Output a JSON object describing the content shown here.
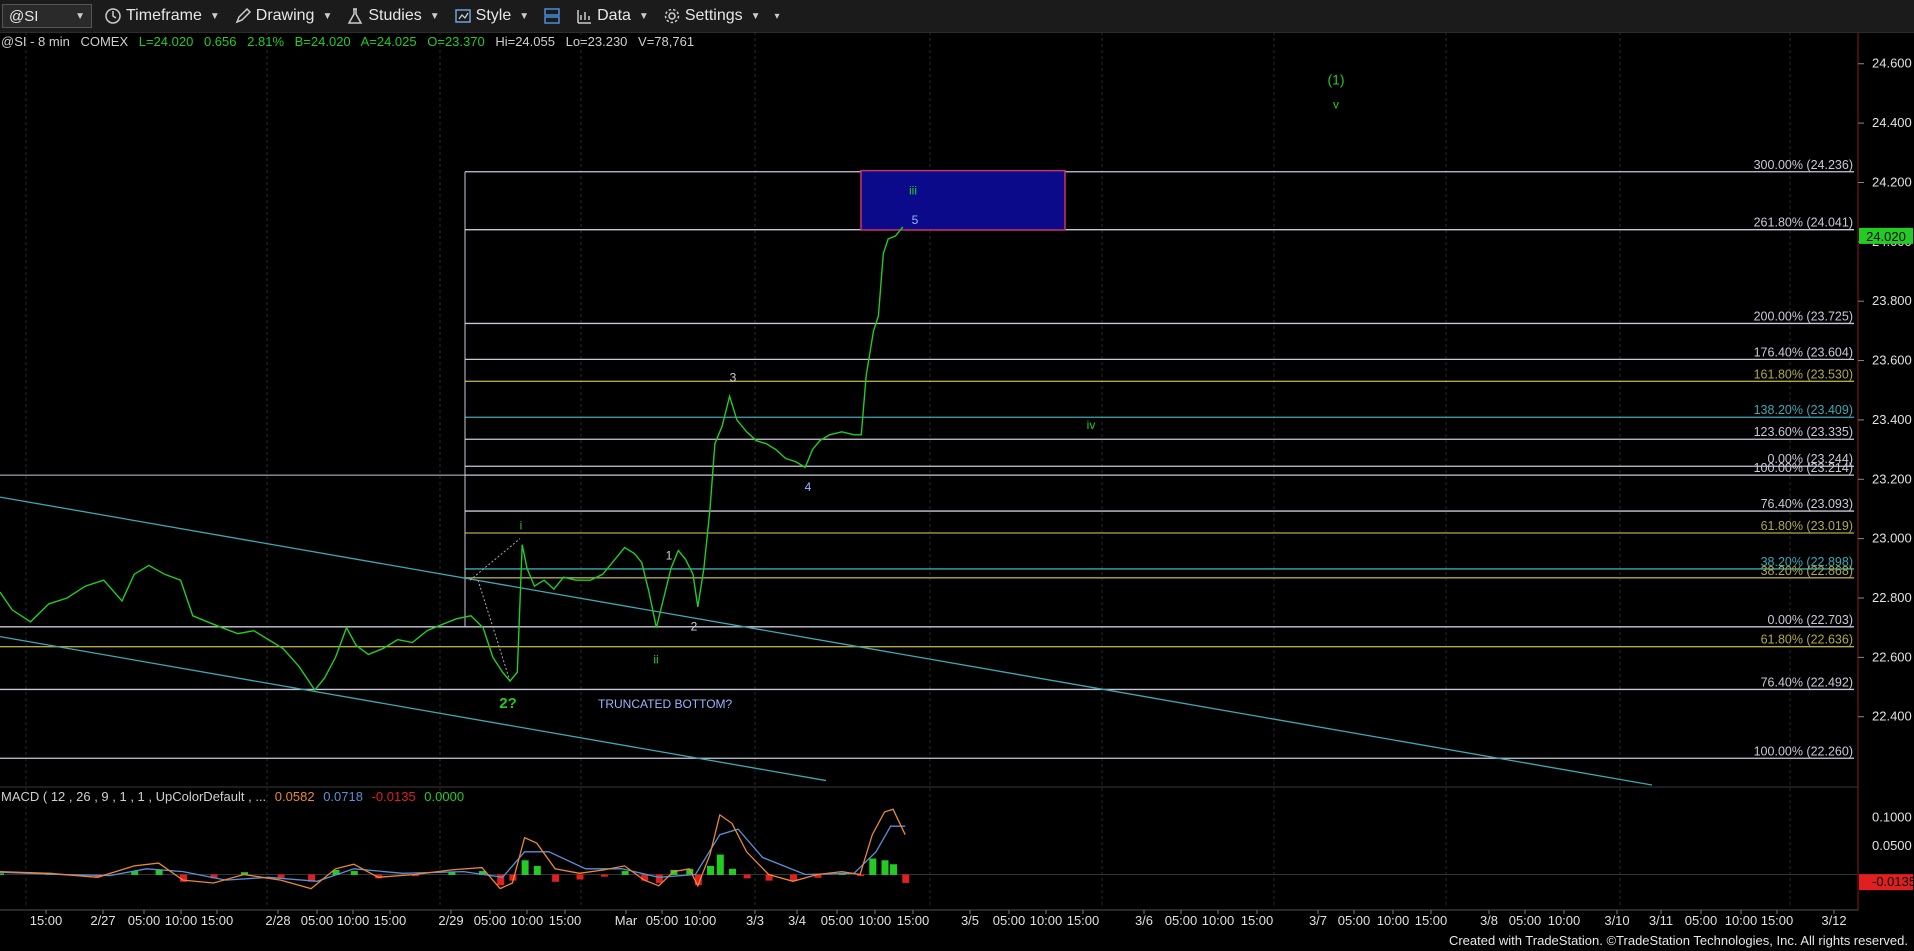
{
  "toolbar": {
    "symbol": "@SI",
    "timeframe_label": "Timeframe",
    "drawing_label": "Drawing",
    "studies_label": "Studies",
    "style_label": "Style",
    "data_label": "Data",
    "settings_label": "Settings"
  },
  "quote": {
    "symbol_desc": "@SI - 8 min",
    "exchange": "COMEX",
    "last": "L=24.020",
    "change": "0.656",
    "pct": "2.81%",
    "bid": "B=24.020",
    "ask": "A=24.025",
    "open": "O=23.370",
    "high": "Hi=24.055",
    "low": "Lo=23.230",
    "volume": "V=78,761"
  },
  "macd_label": {
    "name": "MACD ( 12 , 26 , 9 , 1 , 1 , UpColorDefault , ...",
    "v1": "0.0582",
    "v2": "0.0718",
    "v3": "-0.0135",
    "v4": "0.0000"
  },
  "footer": "Created with TradeStation. ©TradeStation Technologies, Inc. All rights reserved.",
  "colors": {
    "price": "#22cc22",
    "fib_line": "#c8c8d8",
    "trend_channel": "#3fa7b5",
    "target_box": "#0a0a8a",
    "box_border": "#cc3366",
    "macd_line": "#e8883a",
    "signal_line": "#5b8fd6",
    "hist_up": "#22cc22",
    "hist_down": "#e02020"
  },
  "chart_data": {
    "type": "line",
    "symbol": "@SI",
    "interval": "8 min",
    "y_ticks": [
      "24.600",
      "24.400",
      "24.200",
      "24.000",
      "23.800",
      "23.600",
      "23.400",
      "23.200",
      "23.000",
      "22.800",
      "22.600",
      "22.400"
    ],
    "ylim": [
      22.17,
      24.68
    ],
    "last_price_label": "24.020",
    "x_ticks": [
      "15:00",
      "2/27",
      "05:00",
      "10:00",
      "15:00",
      "2/28",
      "05:00",
      "10:00",
      "15:00",
      "2/29",
      "05:00",
      "10:00",
      "15:00",
      "Mar",
      "05:00",
      "10:00",
      "3/3",
      "3/4",
      "05:00",
      "10:00",
      "15:00",
      "3/5",
      "05:00",
      "10:00",
      "15:00",
      "3/6",
      "05:00",
      "10:00",
      "15:00",
      "3/7",
      "05:00",
      "10:00",
      "15:00",
      "3/8",
      "05:00",
      "10:00",
      "3/10",
      "3/11",
      "05:00",
      "10:00",
      "15:00",
      "3/12"
    ],
    "price_series": {
      "name": "@SI",
      "points": [
        [
          0,
          22.82
        ],
        [
          10,
          22.76
        ],
        [
          25,
          22.72
        ],
        [
          40,
          22.78
        ],
        [
          55,
          22.8
        ],
        [
          70,
          22.84
        ],
        [
          85,
          22.86
        ],
        [
          100,
          22.79
        ],
        [
          110,
          22.88
        ],
        [
          122,
          22.91
        ],
        [
          135,
          22.88
        ],
        [
          148,
          22.86
        ],
        [
          158,
          22.74
        ],
        [
          170,
          22.72
        ],
        [
          182,
          22.7
        ],
        [
          195,
          22.68
        ],
        [
          208,
          22.69
        ],
        [
          220,
          22.66
        ],
        [
          232,
          22.63
        ],
        [
          245,
          22.57
        ],
        [
          258,
          22.49
        ],
        [
          266,
          22.53
        ],
        [
          275,
          22.6
        ],
        [
          284,
          22.7
        ],
        [
          292,
          22.64
        ],
        [
          302,
          22.61
        ],
        [
          314,
          22.63
        ],
        [
          326,
          22.66
        ],
        [
          338,
          22.65
        ],
        [
          350,
          22.69
        ],
        [
          362,
          22.71
        ],
        [
          374,
          22.73
        ],
        [
          386,
          22.74
        ],
        [
          396,
          22.7
        ],
        [
          404,
          22.6
        ],
        [
          412,
          22.55
        ],
        [
          418,
          22.52
        ],
        [
          424,
          22.55
        ],
        [
          428,
          22.98
        ],
        [
          432,
          22.9
        ],
        [
          438,
          22.84
        ],
        [
          446,
          22.86
        ],
        [
          454,
          22.83
        ],
        [
          462,
          22.87
        ],
        [
          472,
          22.86
        ],
        [
          484,
          22.86
        ],
        [
          494,
          22.88
        ],
        [
          504,
          22.93
        ],
        [
          512,
          22.97
        ],
        [
          520,
          22.95
        ],
        [
          526,
          22.92
        ],
        [
          532,
          22.82
        ],
        [
          538,
          22.7
        ],
        [
          544,
          22.8
        ],
        [
          550,
          22.9
        ],
        [
          556,
          22.96
        ],
        [
          562,
          22.93
        ],
        [
          568,
          22.88
        ],
        [
          572,
          22.77
        ],
        [
          577,
          22.9
        ],
        [
          582,
          23.1
        ],
        [
          586,
          23.32
        ],
        [
          592,
          23.38
        ],
        [
          598,
          23.48
        ],
        [
          604,
          23.4
        ],
        [
          612,
          23.36
        ],
        [
          620,
          23.33
        ],
        [
          628,
          23.32
        ],
        [
          636,
          23.3
        ],
        [
          644,
          23.27
        ],
        [
          652,
          23.26
        ],
        [
          660,
          23.24
        ],
        [
          666,
          23.3
        ],
        [
          672,
          23.33
        ],
        [
          680,
          23.35
        ],
        [
          690,
          23.36
        ],
        [
          700,
          23.35
        ],
        [
          706,
          23.35
        ],
        [
          710,
          23.55
        ],
        [
          716,
          23.7
        ],
        [
          720,
          23.75
        ],
        [
          724,
          23.96
        ],
        [
          728,
          24.01
        ],
        [
          734,
          24.02
        ],
        [
          740,
          24.05
        ]
      ]
    },
    "fib_levels": [
      {
        "label": "300.00% (24.236)",
        "price": 24.236,
        "color": "#c8c8d8"
      },
      {
        "label": "261.80% (24.041)",
        "price": 24.041,
        "color": "#c8c8d8"
      },
      {
        "label": "200.00% (23.725)",
        "price": 23.725,
        "color": "#c8c8d8"
      },
      {
        "label": "176.40% (23.604)",
        "price": 23.604,
        "color": "#c8c8d8"
      },
      {
        "label": "161.80% (23.530)",
        "price": 23.53,
        "color": "#b0a84a"
      },
      {
        "label": "138.20% (23.409)",
        "price": 23.409,
        "color": "#3fa7b5"
      },
      {
        "label": "123.60% (23.335)",
        "price": 23.335,
        "color": "#c8c8d8"
      },
      {
        "label": "0.00% (23.244)",
        "price": 23.244,
        "color": "#c8c8d8"
      },
      {
        "label": "100.00% (23.214)",
        "price": 23.214,
        "color": "#c8c8d8"
      },
      {
        "label": "76.40% (23.093)",
        "price": 23.093,
        "color": "#c8c8d8"
      },
      {
        "label": "61.80% (23.019)",
        "price": 23.019,
        "color": "#b0a84a"
      },
      {
        "label": "38.20% (22.898)",
        "price": 22.898,
        "color": "#3fa7b5"
      },
      {
        "label": "38.20% (22.868)",
        "price": 22.868,
        "color": "#b0a84a"
      },
      {
        "label": "0.00% (22.703)",
        "price": 22.703,
        "color": "#c8c8d8"
      },
      {
        "label": "61.80% (22.636)",
        "price": 22.636,
        "color": "#b0a84a"
      },
      {
        "label": "76.40% (22.492)",
        "price": 22.492,
        "color": "#c8c8d8"
      },
      {
        "label": "100.00% (22.260)",
        "price": 22.26,
        "color": "#c8c8d8"
      }
    ],
    "wave_labels": [
      {
        "text": "(1)",
        "color": "#22cc22"
      },
      {
        "text": "v",
        "color": "#22cc22"
      },
      {
        "text": "iii",
        "color": "#22cc22"
      },
      {
        "text": "5",
        "color": "#9ab4ff"
      },
      {
        "text": "3",
        "color": "#d0d0d0"
      },
      {
        "text": "iv",
        "color": "#22cc22"
      },
      {
        "text": "4",
        "color": "#9ab4ff"
      },
      {
        "text": "i",
        "color": "#22cc22"
      },
      {
        "text": "1",
        "color": "#d0d0d0"
      },
      {
        "text": "2",
        "color": "#d0d0d0"
      },
      {
        "text": "ii",
        "color": "#22cc22"
      },
      {
        "text": "2?",
        "color": "#22cc22"
      },
      {
        "text": "TRUNCATED BOTTOM?",
        "color": "#9ab4ff"
      }
    ],
    "macd": {
      "y_ticks": [
        "0.1000",
        "0.0500",
        "-0.0135"
      ],
      "ylim": [
        -0.045,
        0.14
      ],
      "macd": [
        [
          0,
          0.005
        ],
        [
          40,
          0.002
        ],
        [
          80,
          -0.005
        ],
        [
          110,
          0.015
        ],
        [
          130,
          0.02
        ],
        [
          150,
          -0.01
        ],
        [
          175,
          -0.015
        ],
        [
          200,
          0.0
        ],
        [
          230,
          -0.01
        ],
        [
          255,
          -0.025
        ],
        [
          275,
          0.01
        ],
        [
          290,
          0.018
        ],
        [
          310,
          -0.005
        ],
        [
          340,
          0.0
        ],
        [
          370,
          0.008
        ],
        [
          395,
          0.012
        ],
        [
          410,
          -0.025
        ],
        [
          420,
          -0.015
        ],
        [
          430,
          0.065
        ],
        [
          440,
          0.055
        ],
        [
          455,
          0.01
        ],
        [
          475,
          0.002
        ],
        [
          495,
          0.008
        ],
        [
          512,
          0.015
        ],
        [
          528,
          -0.01
        ],
        [
          540,
          -0.02
        ],
        [
          552,
          0.005
        ],
        [
          565,
          0.01
        ],
        [
          572,
          -0.02
        ],
        [
          582,
          0.035
        ],
        [
          590,
          0.105
        ],
        [
          600,
          0.09
        ],
        [
          612,
          0.04
        ],
        [
          630,
          0.0
        ],
        [
          650,
          -0.012
        ],
        [
          670,
          0.0
        ],
        [
          690,
          0.005
        ],
        [
          705,
          0.0
        ],
        [
          715,
          0.07
        ],
        [
          725,
          0.11
        ],
        [
          732,
          0.115
        ],
        [
          742,
          0.07
        ]
      ],
      "signal": [
        [
          0,
          0.004
        ],
        [
          50,
          0.0
        ],
        [
          90,
          -0.002
        ],
        [
          120,
          0.01
        ],
        [
          150,
          0.005
        ],
        [
          185,
          -0.01
        ],
        [
          220,
          -0.005
        ],
        [
          260,
          -0.012
        ],
        [
          290,
          0.01
        ],
        [
          330,
          0.002
        ],
        [
          380,
          0.005
        ],
        [
          412,
          -0.005
        ],
        [
          430,
          0.04
        ],
        [
          450,
          0.04
        ],
        [
          480,
          0.01
        ],
        [
          510,
          0.01
        ],
        [
          540,
          -0.005
        ],
        [
          570,
          0.0
        ],
        [
          590,
          0.07
        ],
        [
          605,
          0.08
        ],
        [
          625,
          0.03
        ],
        [
          660,
          0.0
        ],
        [
          700,
          0.002
        ],
        [
          718,
          0.04
        ],
        [
          730,
          0.085
        ],
        [
          742,
          0.085
        ]
      ],
      "hist": [
        [
          0,
          0.002
        ],
        [
          40,
          0.003
        ],
        [
          80,
          -0.004
        ],
        [
          110,
          0.006
        ],
        [
          130,
          0.008
        ],
        [
          150,
          -0.012
        ],
        [
          175,
          -0.006
        ],
        [
          200,
          0.004
        ],
        [
          230,
          -0.005
        ],
        [
          255,
          -0.012
        ],
        [
          275,
          0.008
        ],
        [
          290,
          0.006
        ],
        [
          310,
          -0.006
        ],
        [
          340,
          -0.002
        ],
        [
          370,
          0.004
        ],
        [
          395,
          0.006
        ],
        [
          410,
          -0.018
        ],
        [
          420,
          -0.01
        ],
        [
          430,
          0.025
        ],
        [
          440,
          0.015
        ],
        [
          455,
          -0.012
        ],
        [
          475,
          -0.008
        ],
        [
          495,
          -0.003
        ],
        [
          512,
          0.006
        ],
        [
          528,
          -0.01
        ],
        [
          540,
          -0.014
        ],
        [
          552,
          0.008
        ],
        [
          565,
          0.01
        ],
        [
          572,
          -0.018
        ],
        [
          582,
          0.015
        ],
        [
          590,
          0.035
        ],
        [
          600,
          0.01
        ],
        [
          612,
          -0.006
        ],
        [
          630,
          -0.01
        ],
        [
          650,
          -0.01
        ],
        [
          670,
          -0.005
        ],
        [
          690,
          0.003
        ],
        [
          705,
          -0.002
        ],
        [
          715,
          0.028
        ],
        [
          725,
          0.025
        ],
        [
          732,
          0.018
        ],
        [
          742,
          -0.014
        ]
      ]
    }
  }
}
